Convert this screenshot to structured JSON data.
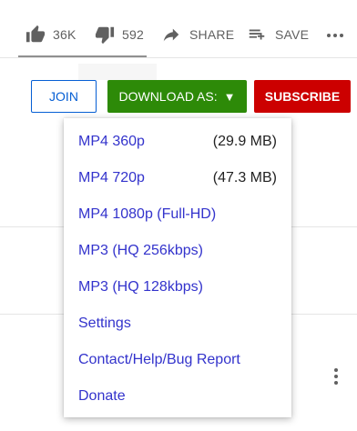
{
  "actions": {
    "like_count": "36K",
    "dislike_count": "592",
    "share_label": "SHARE",
    "save_label": "SAVE"
  },
  "buttons": {
    "join_label": "JOIN",
    "download_label": "DOWNLOAD AS:",
    "download_arrow": "▼",
    "subscribe_label": "SUBSCRIBE"
  },
  "dropdown": {
    "items": [
      {
        "label": "MP4 360p",
        "size": "(29.9 MB)"
      },
      {
        "label": "MP4 720p",
        "size": "(47.3 MB)"
      },
      {
        "label": "MP4 1080p (Full-HD)",
        "size": ""
      },
      {
        "label": "MP3 (HQ 256kbps)",
        "size": ""
      },
      {
        "label": "MP3 (HQ 128kbps)",
        "size": ""
      },
      {
        "label": "Settings",
        "size": ""
      },
      {
        "label": "Contact/Help/Bug Report",
        "size": ""
      },
      {
        "label": "Donate",
        "size": ""
      }
    ]
  },
  "colors": {
    "link": "#3333cc",
    "download_bg": "#2d8a08",
    "subscribe_bg": "#cc0000",
    "join_border": "#065fd4",
    "icon_gray": "#606060"
  }
}
